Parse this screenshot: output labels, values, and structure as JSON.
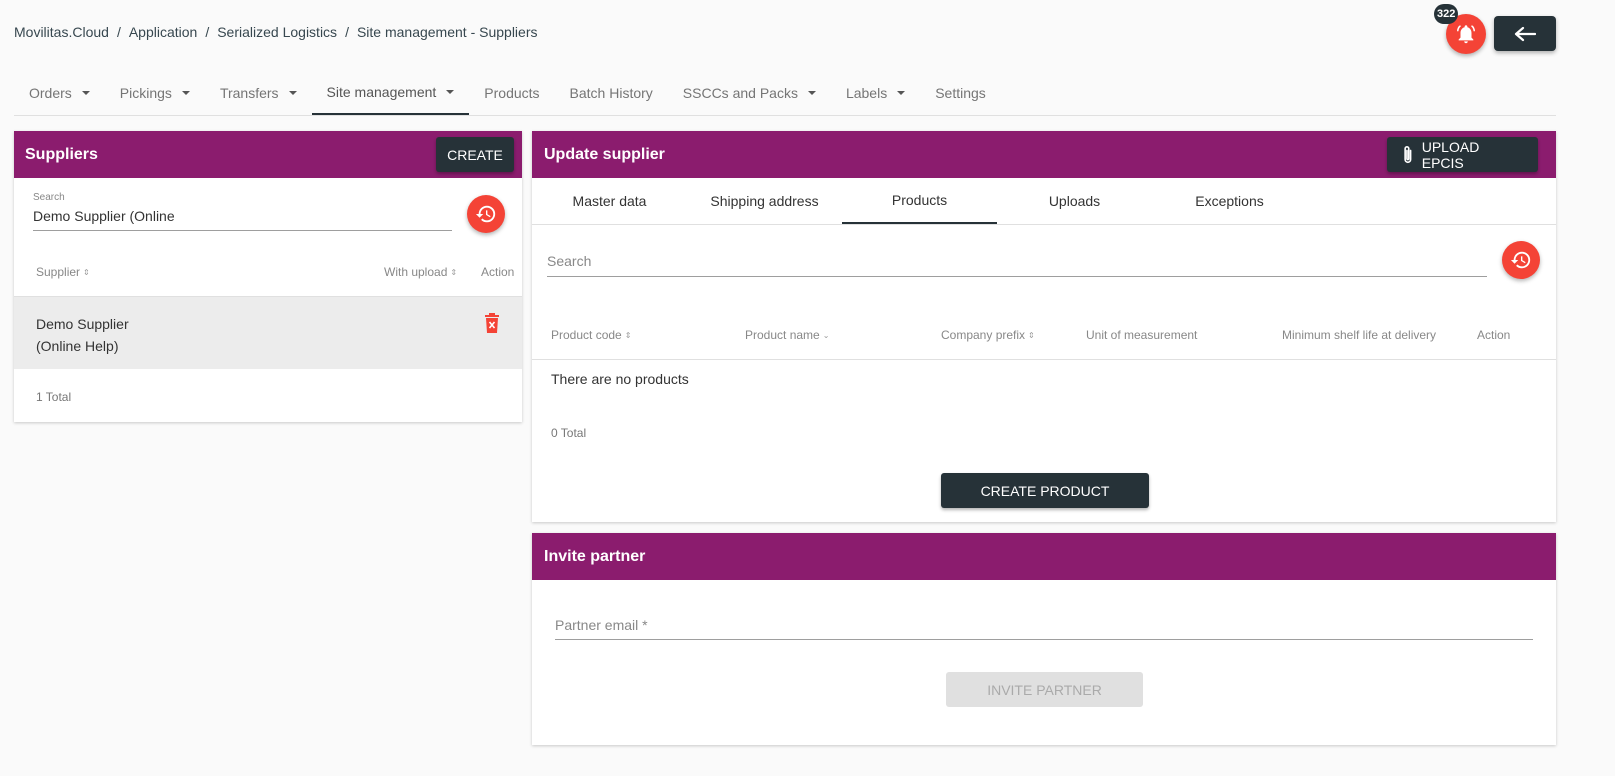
{
  "breadcrumb": [
    "Movilitas.Cloud",
    "Application",
    "Serialized Logistics",
    "Site management - Suppliers"
  ],
  "notifications": {
    "count": "322"
  },
  "nav": [
    {
      "label": "Orders",
      "dropdown": true
    },
    {
      "label": "Pickings",
      "dropdown": true
    },
    {
      "label": "Transfers",
      "dropdown": true
    },
    {
      "label": "Site management",
      "dropdown": true,
      "active": true
    },
    {
      "label": "Products",
      "dropdown": false
    },
    {
      "label": "Batch History",
      "dropdown": false
    },
    {
      "label": "SSCCs and Packs",
      "dropdown": true
    },
    {
      "label": "Labels",
      "dropdown": true
    },
    {
      "label": "Settings",
      "dropdown": false
    }
  ],
  "suppliers": {
    "title": "Suppliers",
    "create_label": "CREATE",
    "search_label": "Search",
    "search_value": "Demo Supplier (Online",
    "col_supplier": "Supplier",
    "col_with_upload": "With upload",
    "col_action": "Action",
    "row_name_line1": "Demo Supplier",
    "row_name_line2": "(Online Help)",
    "total": "1 Total"
  },
  "update": {
    "title": "Update supplier",
    "upload_label": "UPLOAD EPCIS",
    "tabs": [
      "Master data",
      "Shipping address",
      "Products",
      "Uploads",
      "Exceptions"
    ],
    "active_tab": 2,
    "search_placeholder": "Search",
    "columns": [
      "Product code",
      "Product name",
      "Company prefix",
      "Unit of measurement",
      "Minimum shelf life at delivery",
      "Action"
    ],
    "empty_text": "There are no products",
    "total": "0 Total",
    "create_product_label": "CREATE PRODUCT"
  },
  "invite": {
    "title": "Invite partner",
    "email_placeholder": "Partner email *",
    "button_label": "INVITE PARTNER"
  },
  "colors": {
    "header": "#8b1c6e",
    "dark": "#263238",
    "accent": "#f44336"
  }
}
